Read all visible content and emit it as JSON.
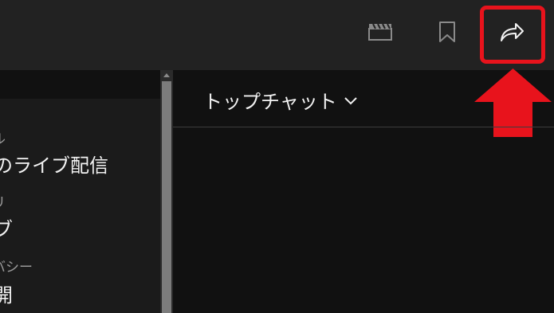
{
  "toolbar": {
    "icons": [
      "clapperboard-icon",
      "bookmark-icon",
      "share-icon"
    ]
  },
  "settings": {
    "fields": [
      {
        "label": "ル",
        "value": "のライブ配信"
      },
      {
        "label": "リ",
        "value": "ブ"
      },
      {
        "label": "バシー",
        "value": "開"
      }
    ]
  },
  "chat": {
    "title": "トップチャット"
  },
  "colors": {
    "topbar": "#222222",
    "background": "#111111",
    "highlight": "#e8131c"
  }
}
